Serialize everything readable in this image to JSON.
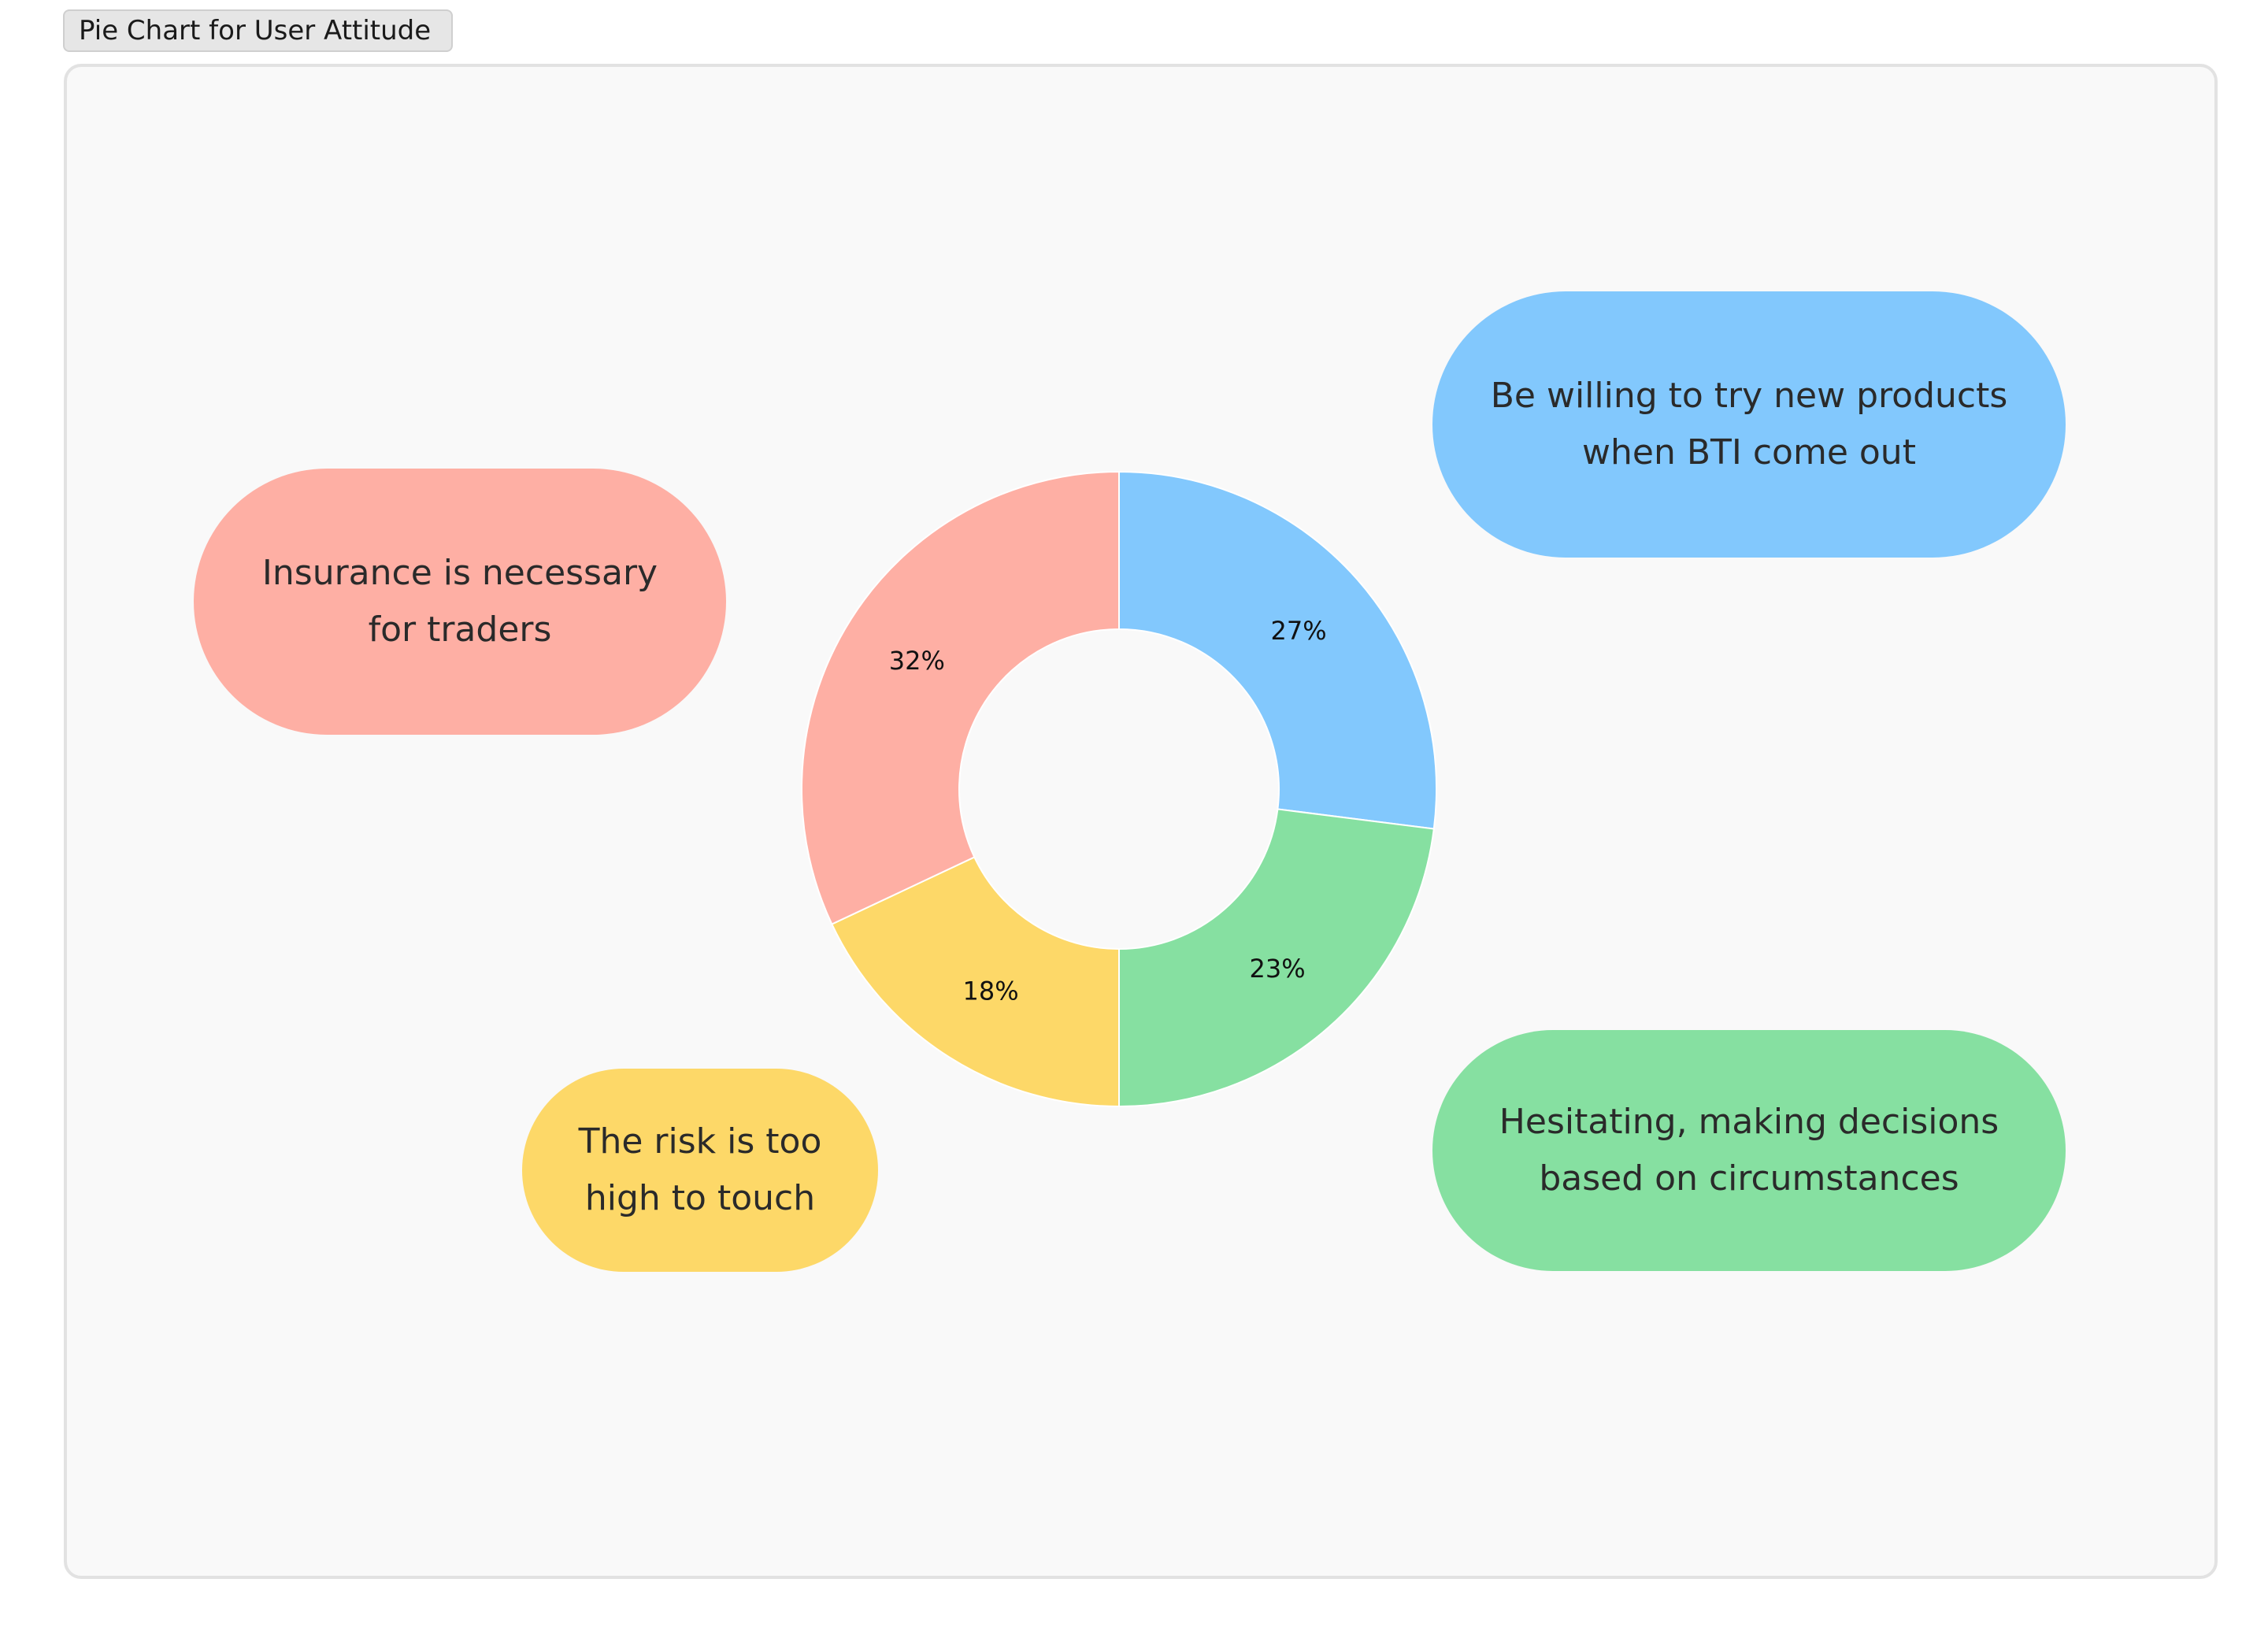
{
  "frame": {
    "title": "Pie Chart for User Attitude"
  },
  "colors": {
    "canvas_bg": "#f9f9f9",
    "blue": "#82c8fd",
    "green": "#86e0a1",
    "yellow": "#fdd868",
    "red": "#feafa4"
  },
  "chart_data": {
    "type": "pie",
    "donut": true,
    "start_angle_deg": 0,
    "direction": "clockwise",
    "slices": [
      {
        "label": "27%",
        "value": 27,
        "color": "#82c8fd"
      },
      {
        "label": "23%",
        "value": 23,
        "color": "#86e0a1"
      },
      {
        "label": "18%",
        "value": 18,
        "color": "#fdd868"
      },
      {
        "label": "32%",
        "value": 32,
        "color": "#feafa4"
      }
    ]
  },
  "callouts": {
    "blue": {
      "line1": "Be willing to try new products",
      "line2": "when BTI come out"
    },
    "green": {
      "line1": "Hesitating, making decisions",
      "line2": "based on circumstances"
    },
    "yellow": {
      "line1": "The risk is too",
      "line2": "high to touch"
    },
    "red": {
      "line1": "Insurance is necessary",
      "line2": "for traders"
    }
  }
}
